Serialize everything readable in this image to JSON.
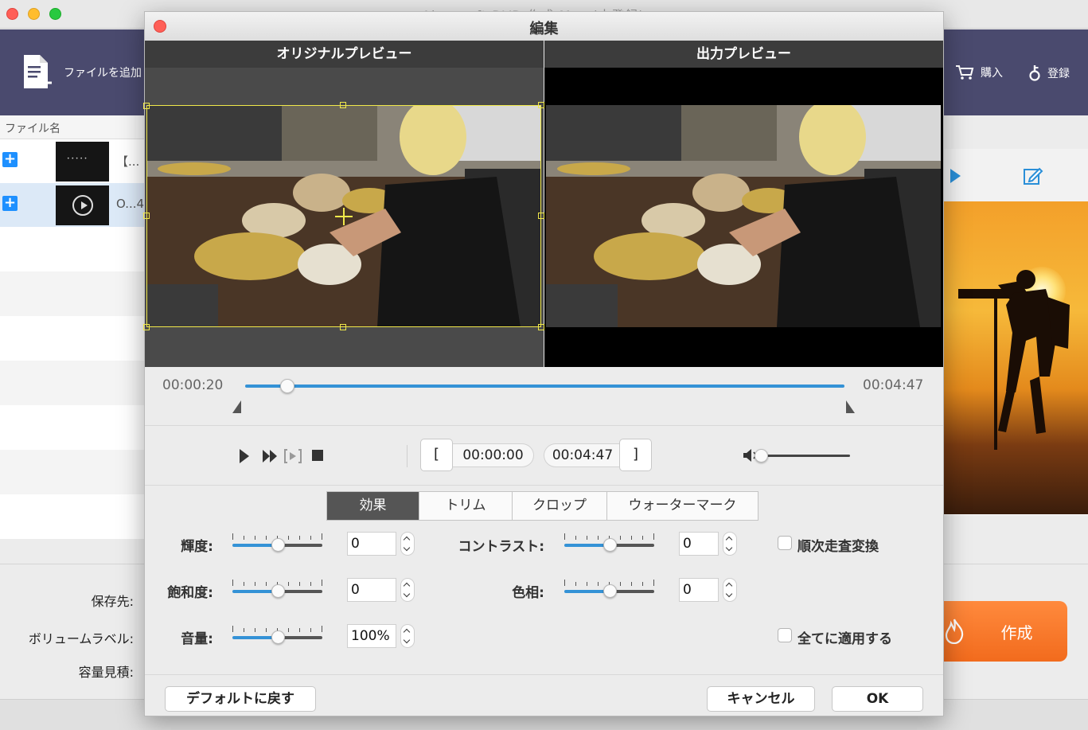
{
  "background_app": {
    "window_title": "Aiseesoft DVD 作成 Mac (未登録)",
    "toolbar": {
      "add_file_label": "ファイルを追加",
      "buy_label": "購入",
      "register_label": "登録"
    },
    "file_list": {
      "column_header": "ファイル名",
      "rows": [
        {
          "name": "【...",
          "thumb_text": "• • • • •"
        },
        {
          "name": "O...4"
        }
      ]
    },
    "bottom": {
      "save_to_label": "保存先:",
      "volume_label": "ボリュームラベル:",
      "capacity_label": "容量見積:"
    },
    "create_label": "作成"
  },
  "dialog": {
    "title": "編集",
    "original_preview_label": "オリジナルプレビュー",
    "output_preview_label": "出力プレビュー",
    "timeline": {
      "current_time": "00:00:20",
      "end_time": "00:04:47",
      "progress_fraction": 0.07
    },
    "controls": {
      "start_time": "00:00:00",
      "end_time": "00:04:47",
      "start_bracket": "[",
      "end_bracket": "]",
      "volume_fraction": 0.0
    },
    "tabs": [
      {
        "label": "効果",
        "active": true
      },
      {
        "label": "トリム",
        "active": false
      },
      {
        "label": "クロップ",
        "active": false
      },
      {
        "label": "ウォーターマーク",
        "active": false
      }
    ],
    "settings": {
      "brightness": {
        "label": "輝度:",
        "value": "0",
        "fraction": 0.5
      },
      "contrast": {
        "label": "コントラスト:",
        "value": "0",
        "fraction": 0.5
      },
      "saturation": {
        "label": "飽和度:",
        "value": "0",
        "fraction": 0.5
      },
      "hue": {
        "label": "色相:",
        "value": "0",
        "fraction": 0.5
      },
      "volume": {
        "label": "音量:",
        "value": "100%",
        "fraction": 0.5
      },
      "deinterlace_label": "順次走査変換",
      "apply_all_label": "全てに適用する"
    },
    "buttons": {
      "reset": "デフォルトに戻す",
      "cancel": "キャンセル",
      "ok": "OK"
    }
  },
  "colors": {
    "accent": "#3492d6",
    "toolbar_bg": "#4a4a6e",
    "crop_box": "#f0e84a",
    "create_button": "#f26b1d",
    "plus_button": "#1e90ff"
  }
}
